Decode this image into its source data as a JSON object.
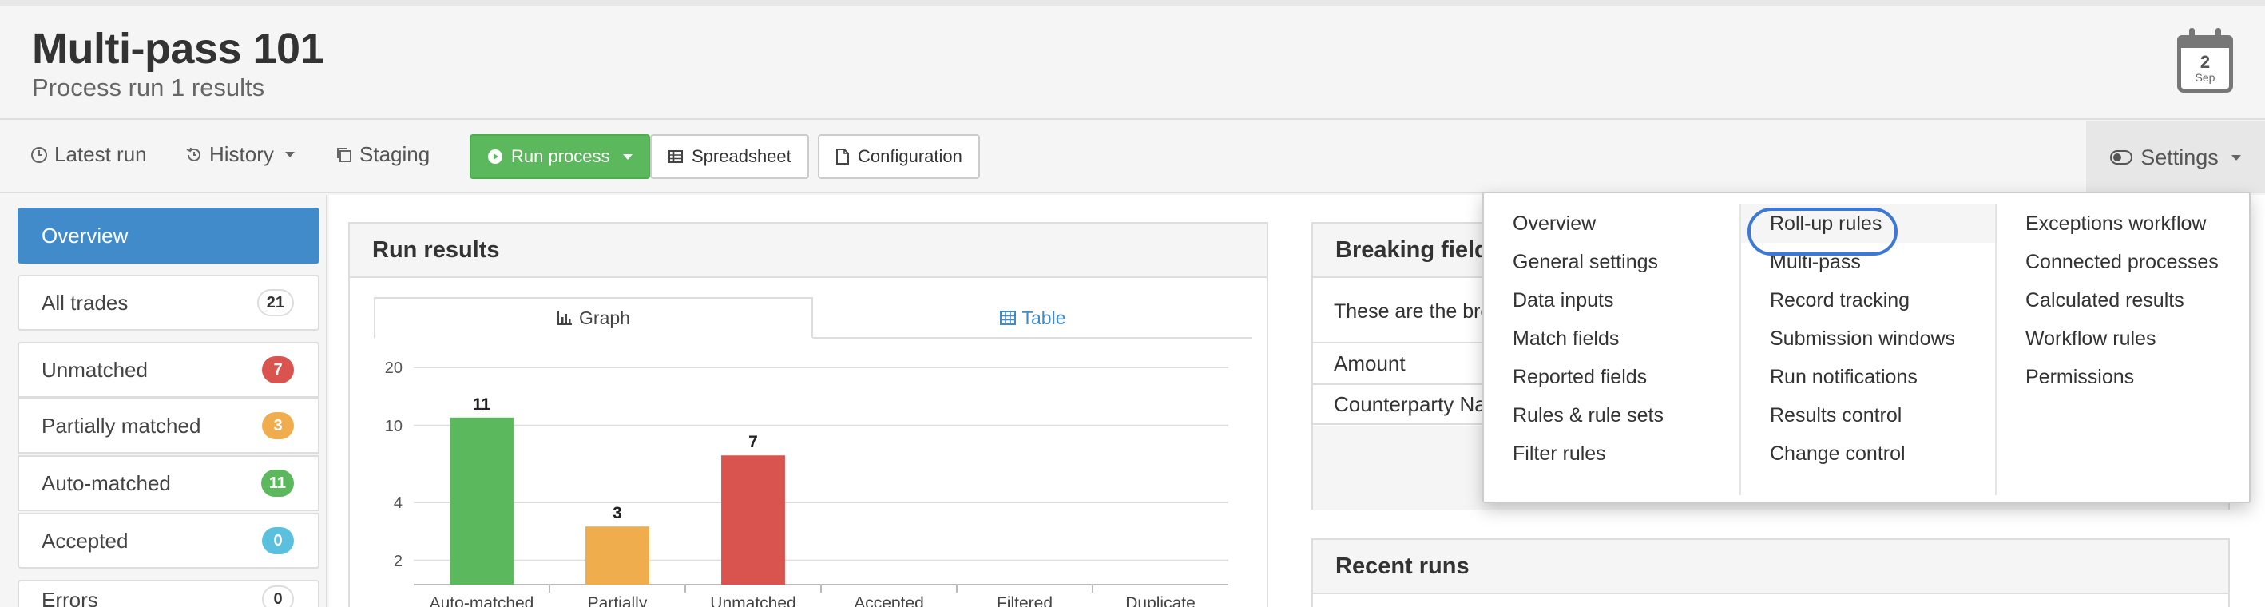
{
  "header": {
    "title": "Multi-pass 101",
    "subtitle": "Process run 1 results",
    "calendar": {
      "day": "2",
      "month": "Sep"
    }
  },
  "toolbar": {
    "latest_run": "Latest run",
    "history": "History",
    "staging": "Staging",
    "run_process": "Run process",
    "spreadsheet": "Spreadsheet",
    "configuration": "Configuration",
    "settings": "Settings"
  },
  "sidebar": {
    "items": [
      {
        "label": "Overview",
        "count": ""
      },
      {
        "label": "All trades",
        "count": "21"
      },
      {
        "label": "Unmatched",
        "count": "7"
      },
      {
        "label": "Partially matched",
        "count": "3"
      },
      {
        "label": "Auto-matched",
        "count": "11"
      },
      {
        "label": "Accepted",
        "count": "0"
      },
      {
        "label": "Errors",
        "count": "0"
      }
    ]
  },
  "run_results": {
    "title": "Run results",
    "tab_graph": "Graph",
    "tab_table": "Table"
  },
  "breaking_fields": {
    "title": "Breaking fields",
    "description": "These are the bre",
    "rows": [
      "Amount",
      "Counterparty Na"
    ]
  },
  "recent_runs": {
    "title": "Recent runs"
  },
  "settings_menu": {
    "col1": [
      "Overview",
      "General settings",
      "Data inputs",
      "Match fields",
      "Reported fields",
      "Rules & rule sets",
      "Filter rules"
    ],
    "col2": [
      "Roll-up rules",
      "Multi-pass",
      "Record tracking",
      "Submission windows",
      "Run notifications",
      "Results control",
      "Change control"
    ],
    "col3": [
      "Exceptions workflow",
      "Connected processes",
      "Calculated results",
      "Workflow rules",
      "Permissions"
    ]
  },
  "colors": {
    "primary": "#428bca",
    "success": "#5cb85c",
    "warning": "#f0ad4e",
    "danger": "#d9534f",
    "info": "#5bc0de"
  },
  "chart_data": {
    "type": "bar",
    "categories": [
      "Auto-matched",
      "Partially",
      "Unmatched",
      "Accepted",
      "Filtered",
      "Duplicate"
    ],
    "values": [
      11,
      3,
      7,
      0,
      0,
      0
    ],
    "data_labels": [
      "11",
      "3",
      "7",
      "",
      "",
      ""
    ],
    "colors": [
      "#5cb85c",
      "#f0ad4e",
      "#d9534f",
      "#5bc0de",
      "#999999",
      "#999999"
    ],
    "y_ticks": [
      "20",
      "10",
      "4",
      "2"
    ],
    "y_tick_values": [
      20,
      10,
      4,
      2
    ],
    "yscale": "log",
    "ylim": [
      1.5,
      20
    ],
    "grid": true
  }
}
